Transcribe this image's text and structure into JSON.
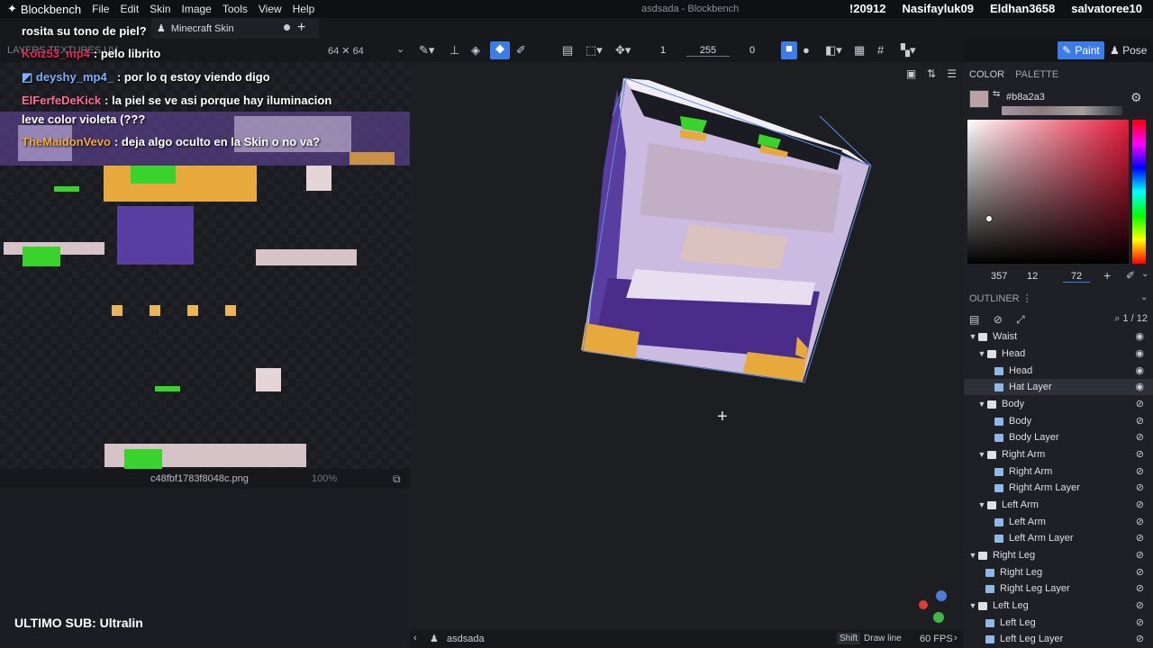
{
  "app": {
    "name": "Blockbench",
    "window_title": "asdsada - Blockbench",
    "menu": [
      "File",
      "Edit",
      "Skin",
      "Image",
      "Tools",
      "View",
      "Help"
    ]
  },
  "overlay": {
    "viewers": [
      "!20912",
      "Nasifayluk09",
      "Eldhan3658",
      "salvatoree10"
    ],
    "chat": [
      {
        "user": "",
        "text": "rosita su tono de piel?",
        "color": "#ffffff"
      },
      {
        "user": "Koiz53_mp4",
        "text": ": pelo librito",
        "color": "#e02a55"
      },
      {
        "user": "deyshy_mp4_",
        "text": ": por lo q estoy viendo digo",
        "color": "#7fb0ff"
      },
      {
        "user": "ElFerfeDeKick",
        "text": ": la piel se ve asi porque hay iluminacion",
        "color": "#ff6b9a"
      },
      {
        "user": "",
        "text": "leve color violeta (???",
        "color": "#ffffff"
      },
      {
        "user": "TheMaidonVevo",
        "text": ": deja algo oculto en la Skin o no va?",
        "color": "#f2a93b"
      }
    ],
    "stream_label": "ULTIMO SUB: Ultralin"
  },
  "tab": {
    "label": "Minecraft Skin"
  },
  "left_panel": {
    "tabs": "LAYERS TEXTURES UV",
    "texture_size": "64 ✕ 64",
    "file_name": "c48fbf1783f8048c.png",
    "zoom": "100%"
  },
  "toolbar": {
    "brush_size": "1",
    "opacity": "255",
    "softness": "0",
    "paint_label": "Paint",
    "pose_label": "Pose"
  },
  "color_panel": {
    "tabs": [
      "COLOR",
      "PALETTE"
    ],
    "hex": "#b8a2a3",
    "swatch": "#b8a2a3",
    "h": "357",
    "s": "12",
    "v": "72"
  },
  "outliner": {
    "title": "OUTLINER",
    "count": "1 / 12",
    "nodes": [
      {
        "label": "Waist",
        "type": "folder",
        "depth": 0,
        "visible": true
      },
      {
        "label": "Head",
        "type": "folder",
        "depth": 1,
        "visible": true
      },
      {
        "label": "Head",
        "type": "cube",
        "depth": 2,
        "visible": true
      },
      {
        "label": "Hat Layer",
        "type": "cube",
        "depth": 2,
        "visible": true,
        "selected": true
      },
      {
        "label": "Body",
        "type": "folder",
        "depth": 1,
        "visible": false
      },
      {
        "label": "Body",
        "type": "cube",
        "depth": 2,
        "visible": false
      },
      {
        "label": "Body Layer",
        "type": "cube",
        "depth": 2,
        "visible": false
      },
      {
        "label": "Right Arm",
        "type": "folder",
        "depth": 1,
        "visible": false
      },
      {
        "label": "Right Arm",
        "type": "cube",
        "depth": 2,
        "visible": false
      },
      {
        "label": "Right Arm Layer",
        "type": "cube",
        "depth": 2,
        "visible": false
      },
      {
        "label": "Left Arm",
        "type": "folder",
        "depth": 1,
        "visible": false
      },
      {
        "label": "Left Arm",
        "type": "cube",
        "depth": 2,
        "visible": false
      },
      {
        "label": "Left Arm Layer",
        "type": "cube",
        "depth": 2,
        "visible": false
      },
      {
        "label": "Right Leg",
        "type": "folder",
        "depth": 0,
        "visible": false
      },
      {
        "label": "Right Leg",
        "type": "cube",
        "depth": 1,
        "visible": false
      },
      {
        "label": "Right Leg Layer",
        "type": "cube",
        "depth": 1,
        "visible": false
      },
      {
        "label": "Left Leg",
        "type": "folder",
        "depth": 0,
        "visible": false
      },
      {
        "label": "Left Leg",
        "type": "cube",
        "depth": 1,
        "visible": false
      },
      {
        "label": "Left Leg Layer",
        "type": "cube",
        "depth": 1,
        "visible": false
      }
    ]
  },
  "status": {
    "model_name": "asdsada",
    "shift_key": "Shift",
    "shift_hint": "Draw line",
    "fps": "60 FPS"
  }
}
